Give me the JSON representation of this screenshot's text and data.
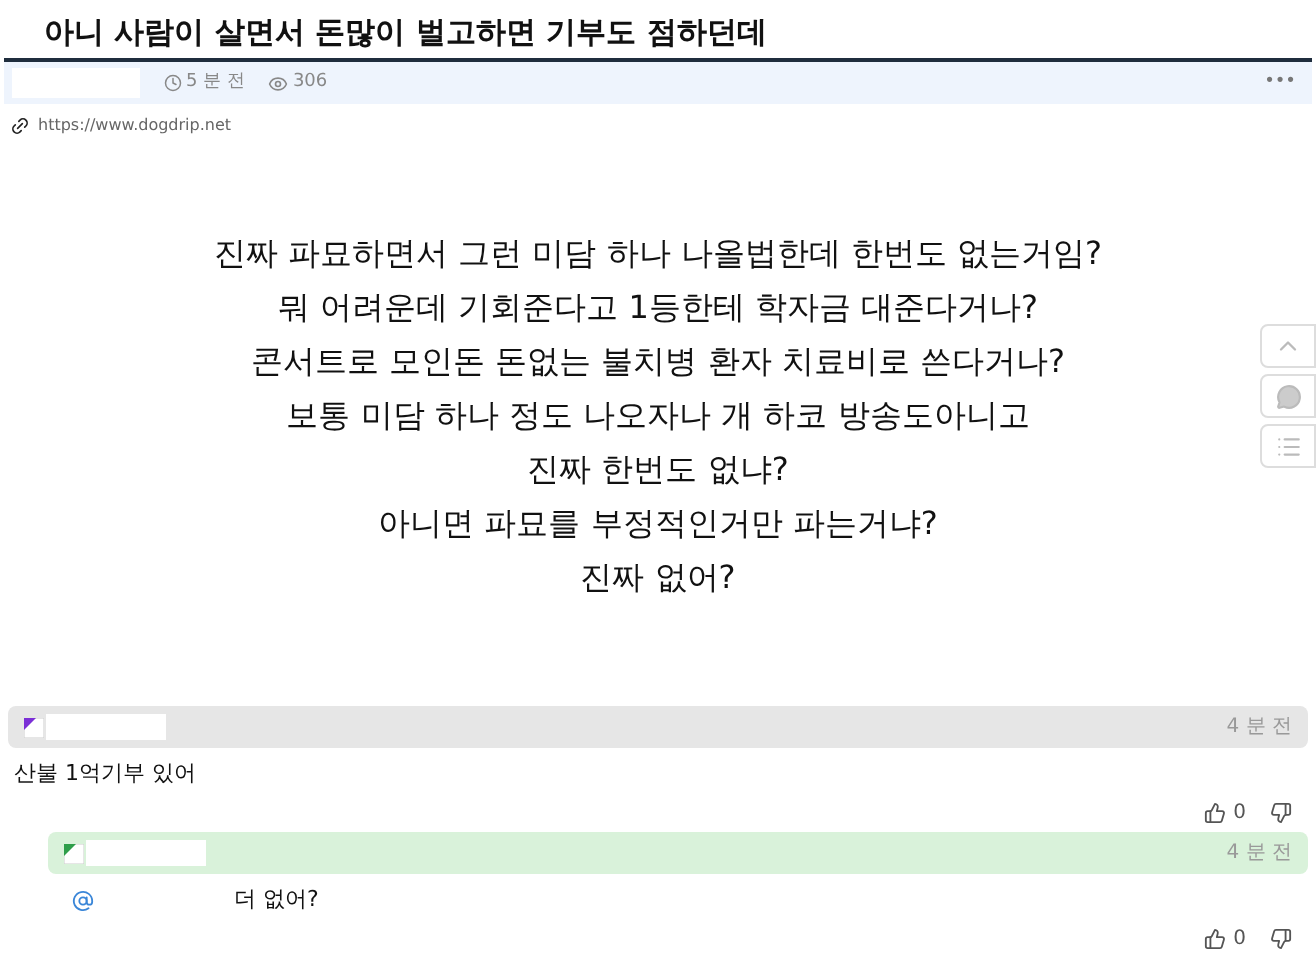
{
  "title": "아니 사람이 살면서 돈많이 벌고하면 기부도 점하던데",
  "meta": {
    "time": "5 분 전",
    "views": "306",
    "more": "•••"
  },
  "source_url": "https://www.dogdrip.net",
  "body": [
    "진짜 파묘하면서 그런 미담 하나 나올법한데 한번도 없는거임?",
    "뭐 어려운데 기회준다고 1등한테 학자금 대준다거나?",
    "콘서트로 모인돈 돈없는 불치병 환자 치료비로 쓴다거나?",
    "보통 미담 하나 정도 나오자나 개 하코 방송도아니고",
    "진짜 한번도 없냐?",
    "아니면 파묘를 부정적인거만 파는거냐?",
    "진짜 없어?"
  ],
  "comments": [
    {
      "kind": "comment",
      "time": "4 분 전",
      "text": "산불 1억기부 있어",
      "likes": "0"
    },
    {
      "kind": "reply",
      "time": "4 분 전",
      "text": "더 없어?",
      "likes": "0"
    }
  ]
}
